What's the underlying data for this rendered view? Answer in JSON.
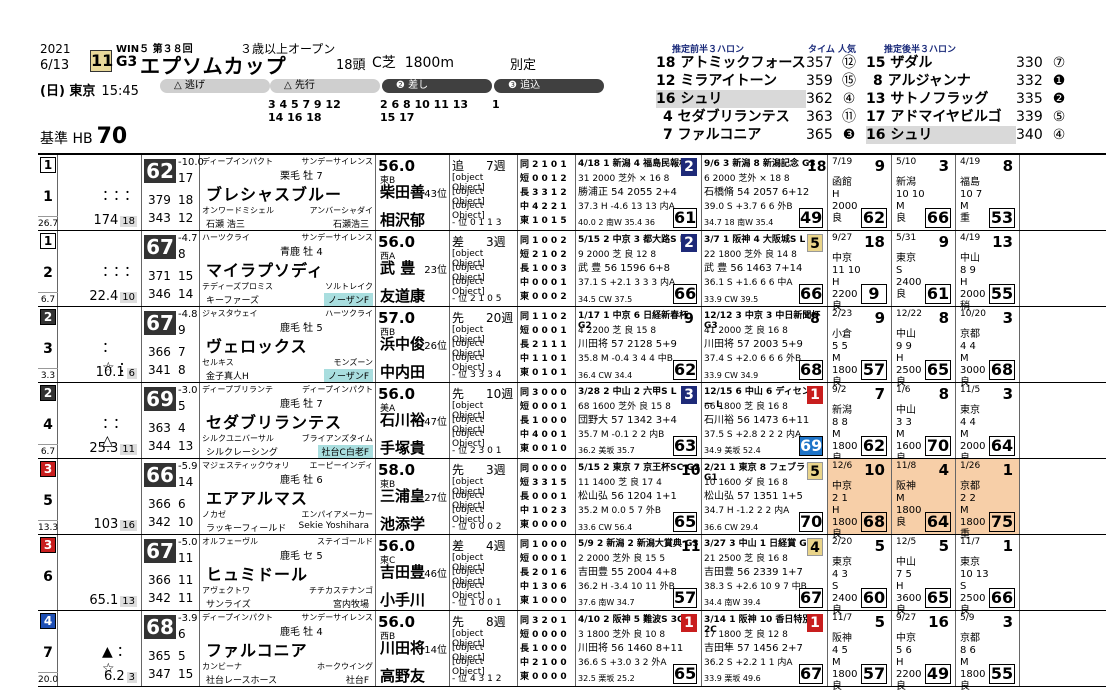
{
  "header": {
    "year": "2021",
    "date": "6/13",
    "race_no": "11",
    "win5_label": "WIN５ 第３８回",
    "grade": "G3",
    "race_name": "エプソムカップ",
    "condition": "３歳以上オープン",
    "heads": "18頭",
    "track": "C芝",
    "distance": "1800m",
    "weight_rule": "別定",
    "day_venue": "(日) 東京",
    "post_time": "15:45",
    "base_label": "基準 HB",
    "base_value": "70",
    "styles": [
      {
        "label": "△ 逃げ",
        "nums": ""
      },
      {
        "label": "△ 先行",
        "nums": "3 4 5 7 9 12\n14 16 18"
      },
      {
        "label": "❷ 差し",
        "nums": "2 6 8 10 11 13\n15 17"
      },
      {
        "label": "❸ 追込",
        "nums": "1"
      }
    ]
  },
  "predictions": {
    "first_header": "推定前半３ハロン",
    "time_header": "タイム 人気",
    "second_header": "推定後半３ハロン",
    "first": [
      {
        "no": "18",
        "name": "アトミックフォース",
        "time": "357",
        "rank": "⑫",
        "hl": false
      },
      {
        "no": "12",
        "name": "ミラアイトーン",
        "time": "359",
        "rank": "⑮",
        "hl": false
      },
      {
        "no": "16",
        "name": "シュリ",
        "time": "362",
        "rank": "④",
        "hl": true
      },
      {
        "no": "4",
        "name": "セダブリランテス",
        "time": "363",
        "rank": "⑪",
        "hl": false
      },
      {
        "no": "7",
        "name": "ファルコニア",
        "time": "365",
        "rank": "❸",
        "hl": false
      }
    ],
    "second": [
      {
        "no": "15",
        "name": "ザダル",
        "time": "330",
        "rank": "⑦",
        "hl": false
      },
      {
        "no": "8",
        "name": "アルジャンナ",
        "time": "332",
        "rank": "❶",
        "hl": false
      },
      {
        "no": "13",
        "name": "サトノフラッグ",
        "time": "335",
        "rank": "❷",
        "hl": false
      },
      {
        "no": "17",
        "name": "アドマイヤビルゴ",
        "time": "339",
        "rank": "⑤",
        "hl": false
      },
      {
        "no": "16",
        "name": "シュリ",
        "time": "340",
        "rank": "④",
        "hl": true
      }
    ]
  },
  "horses": [
    {
      "frame": "1",
      "no": "1",
      "pop": "26.7",
      "marks": "：：：",
      "odds": "174",
      "odds_pop": "18",
      "idx": "62",
      "diff": "-10.0",
      "v1": "17",
      "v2": "379",
      "v3": "18",
      "v4": "343",
      "v5": "12",
      "sire": "ディープインパクト",
      "bms": "サンデーサイレンス",
      "coat": "栗毛  牡 7",
      "name": "ブレシャスブルー",
      "dam": "オンワードミシェル",
      "damsire": "アンバーシャダイ",
      "breeder": "石瀬 浩三",
      "owner": "石瀬浩三",
      "owner_teal": false,
      "weight": "56.0",
      "trainer_area": "東B",
      "trainer": "柴田善",
      "jockey": "相沢郁",
      "age": "43位",
      "style": "追",
      "weeks": "7週",
      "s1": {
        "date": "7/19",
        "place": "9",
        "venue": "函館\nH\n2000\n良",
        "idx": "62"
      },
      "s2": {
        "date": "5/10",
        "place": "3",
        "venue": "新潟\n10 10\nM\n良",
        "idx": "66"
      },
      "s3": {
        "date": "4/19",
        "place": "8",
        "venue": "福島\n10 7\nM\n重",
        "idx": "53"
      },
      "s4": "- 位 0 1 1 3",
      "r1": "同 2 1 0 1",
      "r2": "短 0 0 1 2",
      "r3": "長 3 3 1 2",
      "r4": "中 4 2 2 1",
      "r5": "東 1 0 1 5",
      "p1": {
        "top": "4/18 1 新潟 4 福島民報杯 L",
        "place": "2",
        "color": "",
        "l2": "31 2000 芝外 × 16 8",
        "l3": "勝浦正 54 2055 2+4",
        "l4": "37.3 H -4.6 13 13 内A",
        "l5": "40.0 2 南W 35.4 36",
        "idx": "61",
        "blue": false
      },
      "p2": {
        "top": "9/6 3 新潟 8 新潟記念 G3",
        "place": "18",
        "color": "plain",
        "l2": "6 2000 芝外 × 18 8",
        "l3": "石橋脩 54 2057 6+12",
        "l4": "39.0 S +3.7 6 6 外B",
        "l5": "34.7 18 南W 35.4",
        "idx": "49",
        "blue": false
      }
    },
    {
      "frame": "1",
      "no": "2",
      "pop": "6.7",
      "marks": "：：：",
      "odds": "22.4",
      "odds_pop": "10",
      "idx": "67",
      "diff": "-4.7",
      "v1": "8",
      "v2": "371",
      "v3": "15",
      "v4": "346",
      "v5": "14",
      "sire": "ハーツクライ",
      "bms": "サンデーサイレンス",
      "coat": "青鹿  牡 4",
      "name": "マイラプソディ",
      "dam": "テディーズプロミス",
      "damsire": "ソルトレイク",
      "breeder": "キーファーズ",
      "owner": "ノーザンF",
      "owner_teal": true,
      "weight": "56.0",
      "trainer_area": "西A",
      "trainer": "武 豊",
      "jockey": "友道康",
      "age": "23位",
      "style": "差",
      "weeks": "3週",
      "s1": {
        "date": "9/27",
        "place": "18",
        "venue": "中京\n11 10\nH\n2200\n良",
        "idx": "9"
      },
      "s2": {
        "date": "5/31",
        "place": "9",
        "venue": "東京\nS\n2400\n良",
        "idx": "61"
      },
      "s3": {
        "date": "4/19",
        "place": "13",
        "venue": "中山\n8 9\nH\n2000\n稍",
        "idx": "55"
      },
      "s4": "- 位 2 1 0 5",
      "r1": "同 1 0 0 2",
      "r2": "短 2 1 0 2",
      "r3": "長 1 0 0 3",
      "r4": "中 0 0 0 1",
      "r5": "東 0 0 0 2",
      "p1": {
        "top": "5/15 2 中京 3 都大路S L",
        "place": "2",
        "color": "",
        "l2": "9 2000 芝 良 12 8",
        "l3": "武 豊 56 1596 6+8",
        "l4": "37.1 S +2.1 3 3 3 内A",
        "l5": "34.5 CW 37.5",
        "idx": "66",
        "blue": false
      },
      "p2": {
        "top": "3/7 1 阪神 4 大阪城S L",
        "place": "5",
        "color": "yel",
        "l2": "22 1800 芝外 良 14 8",
        "l3": "武 豊 56 1463 7+14",
        "l4": "36.1 S +1.6 6 6 中A",
        "l5": "33.9 CW 39.5",
        "idx": "66",
        "blue": false
      }
    },
    {
      "frame": "2",
      "no": "3",
      "pop": "3.3",
      "marks": "：☆：",
      "odds": "10.1",
      "odds_pop": "6",
      "idx": "67",
      "diff": "-4.8",
      "v1": "9",
      "v2": "366",
      "v3": "7",
      "v4": "341",
      "v5": "8",
      "sire": "ジャスタウェイ",
      "bms": "ハーツクライ",
      "coat": "鹿毛  牡 5",
      "name": "ヴェロックス",
      "dam": "セルキス",
      "damsire": "モンズーン",
      "breeder": "金子真人H",
      "owner": "ノーザンF",
      "owner_teal": true,
      "weight": "57.0",
      "trainer_area": "西B",
      "trainer": "浜中俊",
      "jockey": "中内田",
      "age": "26位",
      "style": "先",
      "weeks": "20週",
      "s1": {
        "date": "2/23",
        "place": "9",
        "venue": "小倉\n5 5\nM\n1800\n良",
        "idx": "57"
      },
      "s2": {
        "date": "12/22",
        "place": "8",
        "venue": "中山\n9 9\nH\n2500\n良",
        "idx": "65"
      },
      "s3": {
        "date": "10/20",
        "place": "3",
        "venue": "京都\n4 4\nM\n3000\n良",
        "idx": "68"
      },
      "s4": "- 位 3 3 3 4",
      "r1": "同 1 1 0 2",
      "r2": "短 0 0 0 1",
      "r3": "長 2 1 1 1",
      "r4": "中 1 1 0 1",
      "r5": "東 0 1 0 1",
      "p1": {
        "top": "1/17 1 中京 6 日経新春杯 G2",
        "place": "9",
        "color": "plain",
        "l2": "4 2200 芝 良 15 8",
        "l3": "川田将 57 2128 5+9",
        "l4": "35.8 M -0.4 3 4 4 中B",
        "l5": "36.4 CW 34.4",
        "idx": "62",
        "blue": false
      },
      "p2": {
        "top": "12/12 3 中京 3 中日新聞杯 G3",
        "place": "8",
        "color": "plain",
        "l2": "41 2000 芝 良 16 8",
        "l3": "川田将 57 2003 5+9",
        "l4": "37.4 S +2.0 6 6 6 外B",
        "l5": "33.9 CW 34.9",
        "idx": "68",
        "blue": false
      }
    },
    {
      "frame": "2",
      "no": "4",
      "pop": "6.7",
      "marks": "：：△",
      "odds": "25.3",
      "odds_pop": "11",
      "idx": "69",
      "diff": "-3.0",
      "v1": "5",
      "v2": "363",
      "v3": "4",
      "v4": "344",
      "v5": "13",
      "sire": "ディープブリランテ",
      "bms": "ディープインパクト",
      "coat": "鹿毛  牡 7",
      "name": "セダブリランテス",
      "dam": "シルクユニバーサル",
      "damsire": "ブライアンズタイム",
      "breeder": "シルクレーシング",
      "owner": "社台C白老F",
      "owner_teal": true,
      "weight": "56.0",
      "trainer_area": "美A",
      "trainer": "石川裕",
      "jockey": "手塚貴",
      "age": "47位",
      "style": "先",
      "weeks": "10週",
      "s1": {
        "date": "9/2",
        "place": "7",
        "venue": "新潟\n8 8\nM\n1800\n良",
        "idx": "62"
      },
      "s2": {
        "date": "1/6",
        "place": "8",
        "venue": "中山\n3 3\nM\n1600\n良",
        "idx": "70"
      },
      "s3": {
        "date": "11/5",
        "place": "3",
        "venue": "東京\n4 4\nM\n2000\n良",
        "idx": "64"
      },
      "s4": "- 位 2 3 0 1",
      "r1": "同 3 0 0 0",
      "r2": "短 0 0 0 1",
      "r3": "長 1 0 0 0",
      "r4": "中 4 0 0 1",
      "r5": "東 0 0 1 0",
      "p1": {
        "top": "3/28 2 中山 2 六甲S L",
        "place": "3",
        "color": "",
        "l2": "68 1600 芝外 良 15 8",
        "l3": "団野大 57 1342 3+4",
        "l4": "35.7 M -0.1 2 2 内B",
        "l5": "36.2 美坂 35.7",
        "idx": "63",
        "blue": false
      },
      "p2": {
        "top": "12/15 6 中山 6 ディセンバー L",
        "place": "1",
        "color": "red",
        "l2": "66 1800 芝 良 16 8",
        "l3": "石川裕 56 1473 6+11",
        "l4": "37.5 S +2.8 2 2 2 内A",
        "l5": "34.9 美坂 52.4",
        "idx": "69",
        "blue": true
      }
    },
    {
      "frame": "3",
      "no": "5",
      "pop": "13.3",
      "marks": "",
      "odds": "103",
      "odds_pop": "16",
      "idx": "66",
      "diff": "-5.9",
      "v1": "14",
      "v2": "366",
      "v3": "6",
      "v4": "342",
      "v5": "10",
      "sire": "マジェスティックウォリ",
      "bms": "エーピーインディ",
      "coat": "鹿毛  牡 6",
      "name": "エアアルマス",
      "dam": "ノカゼ",
      "damsire": "エンパイアメーカー",
      "breeder": "ラッキーフィールド",
      "owner": "Sekie Yoshihara",
      "owner_teal": false,
      "weight": "58.0",
      "trainer_area": "東B",
      "trainer": "三浦皇",
      "jockey": "池添学",
      "age": "27位",
      "style": "先",
      "weeks": "3週",
      "s1": {
        "date": "12/6",
        "place": "10",
        "venue": "中京\n2 1\nH\n1800\n良",
        "idx": "68"
      },
      "s2": {
        "date": "11/8",
        "place": "4",
        "venue": "阪神\nM\n1800\n良",
        "idx": "64"
      },
      "s3": {
        "date": "1/26",
        "place": "1",
        "venue": "京都\n2 2\nM\n1800\n重",
        "idx": "75"
      },
      "s4": "- 位 0 0 0 2",
      "r1": "同 0 0 0 0",
      "r2": "短 3 3 1 5",
      "r3": "長 0 0 0 1",
      "r4": "中 1 0 2 3",
      "r5": "東 0 0 0 0",
      "p1": {
        "top": "5/15 2 東京 7 京王杯SC G2",
        "place": "10",
        "color": "plain",
        "l2": "11 1400 芝 良 17 4",
        "l3": "松山弘 56 1204 1+1",
        "l4": "35.2 M 0.0 5 7 外B",
        "l5": "33.6 CW 56.4",
        "idx": "65",
        "blue": false
      },
      "p2": {
        "top": "2/21 1 東京 8 フェブラリー G1",
        "place": "5",
        "color": "yel",
        "l2": "10 1600 ダ 良 16 8",
        "l3": "松山弘 57 1351 1+5",
        "l4": "34.7 H -1.2 2 2 内A",
        "l5": "36.6 CW 29.4",
        "idx": "70",
        "blue": false
      },
      "orange": true
    },
    {
      "frame": "3",
      "no": "6",
      "pop": "",
      "marks": "",
      "odds": "65.1",
      "odds_pop": "13",
      "idx": "67",
      "diff": "-5.0",
      "v1": "11",
      "v2": "366",
      "v3": "11",
      "v4": "342",
      "v5": "11",
      "sire": "オルフェーヴル",
      "bms": "ステイゴールド",
      "coat": "鹿毛  セ 5",
      "name": "ヒュミドール",
      "dam": "アヴェクトワ",
      "damsire": "チチカステナンゴ",
      "breeder": "サンライズ",
      "owner": "宮内牧場",
      "owner_teal": false,
      "weight": "56.0",
      "trainer_area": "東C",
      "trainer": "吉田豊",
      "jockey": "小手川",
      "age": "46位",
      "style": "差",
      "weeks": "4週",
      "s1": {
        "date": "2/20",
        "place": "5",
        "venue": "東京\n4 3\nS\n2400\n良",
        "idx": "60"
      },
      "s2": {
        "date": "12/5",
        "place": "5",
        "venue": "中山\n7 5\nH\n3600\n良",
        "idx": "65"
      },
      "s3": {
        "date": "11/7",
        "place": "1",
        "venue": "東京\n10 13\nS\n2500\n良",
        "idx": "66"
      },
      "s4": "- 位 1 0 0 1",
      "r1": "同 1 0 0 0",
      "r2": "短 0 0 0 1",
      "r3": "長 2 0 1 6",
      "r4": "中 1 3 0 6",
      "r5": "東 1 0 0 0",
      "p1": {
        "top": "5/9 2 新潟 2 新潟大賞典 G3",
        "place": "11",
        "color": "plain",
        "l2": "2 2000 芝外 良 15 5",
        "l3": "吉田豊 55 2004 4+8",
        "l4": "36.2 H -3.4 10 11 外B",
        "l5": "37.6 南W 34.7",
        "idx": "57",
        "blue": false
      },
      "p2": {
        "top": "3/27 3 中山 1 日経賞 G2",
        "place": "4",
        "color": "yel",
        "l2": "21 2500 芝 良 16 8",
        "l3": "吉田豊 56 2339 1+7",
        "l4": "38.3 S +2.6 10 9 7 中B",
        "l5": "34.4 南W 39.4",
        "idx": "67",
        "blue": false
      }
    },
    {
      "frame": "4",
      "no": "7",
      "pop": "20.0",
      "marks": "▲：☆",
      "odds": "6.2",
      "odds_pop": "3",
      "idx": "68",
      "diff": "-3.9",
      "v1": "6",
      "v2": "365",
      "v3": "5",
      "v4": "347",
      "v5": "15",
      "sire": "ディープインパクト",
      "bms": "サンデーサイレンス",
      "coat": "鹿毛  牡 4",
      "name": "ファルコニア",
      "dam": "カンビーナ",
      "damsire": "ホークウイング",
      "breeder": "社台レースホース",
      "owner": "社台F",
      "owner_teal": false,
      "weight": "56.0",
      "trainer_area": "西B",
      "trainer": "川田将",
      "jockey": "高野友",
      "age": "14位",
      "style": "先",
      "weeks": "8週",
      "s1": {
        "date": "11/7",
        "place": "5",
        "venue": "阪神\n4 5\nM\n1800\n良",
        "idx": "57"
      },
      "s2": {
        "date": "9/27",
        "place": "16",
        "venue": "中京\n5 6\nH\n2200\n良",
        "idx": "49"
      },
      "s3": {
        "date": "5/9",
        "place": "3",
        "venue": "京都\n8 6\nM\n1800\n良",
        "idx": "55"
      },
      "s4": "- 位 4 3 1 2",
      "r1": "同 3 2 0 1",
      "r2": "短 0 0 0 0",
      "r3": "長 1 0 0 0",
      "r4": "中 2 1 0 0",
      "r5": "東 0 0 0 0",
      "p1": {
        "top": "4/10 2 阪神 5 難波S 3C",
        "place": "1",
        "color": "red",
        "l2": "3 1800 芝外 良 10 8",
        "l3": "川田将 56 1460 8+11",
        "l4": "36.6 S +3.0 3 2 外A",
        "l5": "32.5 栗坂 25.2",
        "idx": "65",
        "blue": false
      },
      "p2": {
        "top": "3/14 1 阪神 10 香日特別 2C",
        "place": "1",
        "color": "red",
        "l2": "17 1800 芝 良 12 8",
        "l3": "吉田隼 57 1456 2+7",
        "l4": "36.2 S +2.2 1 1 内A",
        "l5": "33.9 栗坂 49.6",
        "idx": "67",
        "blue": false
      }
    }
  ],
  "colors": {
    "frame1": "#ffffff",
    "frame2": "#333333",
    "frame3": "#c81e1e",
    "frame4": "#1e4fb4",
    "teal": "#a9dedf",
    "orange": "#f7cfa8"
  }
}
